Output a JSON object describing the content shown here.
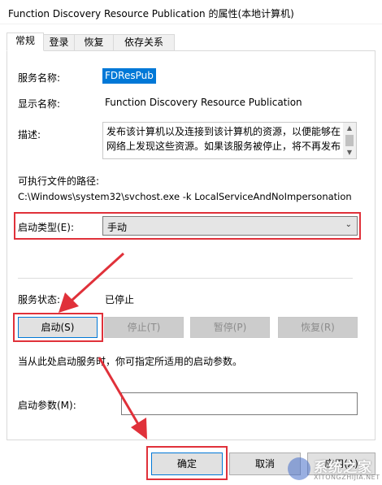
{
  "window": {
    "title": "Function Discovery Resource Publication 的属性(本地计算机)"
  },
  "tabs": [
    {
      "label": "常规",
      "active": true
    },
    {
      "label": "登录",
      "active": false
    },
    {
      "label": "恢复",
      "active": false
    },
    {
      "label": "依存关系",
      "active": false
    }
  ],
  "general": {
    "service_name_label": "服务名称:",
    "service_name_value": "FDResPub",
    "display_name_label": "显示名称:",
    "display_name_value": "Function Discovery Resource Publication",
    "description_label": "描述:",
    "description_value": "发布该计算机以及连接到该计算机的资源，以便能够在网络上发现这些资源。如果该服务被停止，将不再发布",
    "exe_path_label": "可执行文件的路径:",
    "exe_path_value": "C:\\Windows\\system32\\svchost.exe -k LocalServiceAndNoImpersonation",
    "startup_type_label": "启动类型(E):",
    "startup_type_value": "手动",
    "service_status_label": "服务状态:",
    "service_status_value": "已停止",
    "start_button": "启动(S)",
    "stop_button": "停止(T)",
    "pause_button": "暂停(P)",
    "resume_button": "恢复(R)",
    "start_params_hint": "当从此处启动服务时，你可指定所适用的启动参数。",
    "start_params_label": "启动参数(M):",
    "start_params_value": ""
  },
  "footer": {
    "ok_button": "确定",
    "cancel_button": "取消",
    "apply_button": "应用(A)"
  },
  "watermark": {
    "text": "系统之家",
    "sub": "XITONGZHIJIA.NET"
  },
  "colors": {
    "highlight_border": "#e0313a",
    "selection": "#0078d7",
    "annotation_arrow": "#e0313a"
  },
  "icons": [
    "scroll-up-icon",
    "scroll-down-icon",
    "chevron-down-icon",
    "watermark-logo-icon"
  ]
}
